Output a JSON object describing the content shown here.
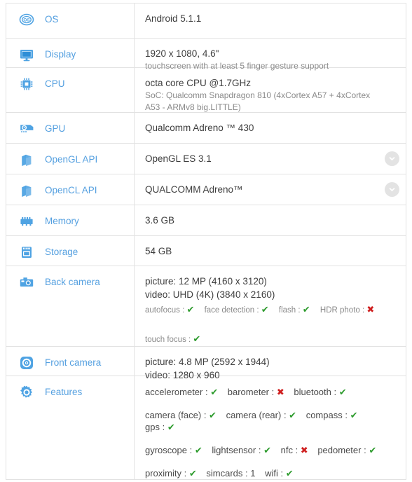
{
  "colors": {
    "label_blue": "#55a0e0",
    "icon_blue": "#4fa3e3",
    "value_dark": "#3d3d3d",
    "value_sub_gray": "#8a8a8a",
    "yes_green": "#2d9b2d",
    "no_red": "#cf1f1f",
    "border_gray": "#e2e2e2",
    "chevron_bg": "#e3e3e3"
  },
  "glyphs": {
    "check": "✔",
    "cross": "✖"
  },
  "rows": [
    {
      "key": "os",
      "icon": "os-icon",
      "label": "OS",
      "value_main": "Android 5.1.1",
      "expandable": false
    },
    {
      "key": "display",
      "icon": "display-monitor-icon",
      "label": "Display",
      "value_main": "1920 x 1080, 4.6\"",
      "value_sub": "touchscreen with at least 5 finger gesture support",
      "expandable": false
    },
    {
      "key": "cpu",
      "icon": "cpu-chip-icon",
      "label": "CPU",
      "value_main": "octa core CPU @1.7GHz",
      "value_sub": "SoC: Qualcomm Snapdragon 810 (4xCortex A57 + 4xCortex A53 - ARMv8 big.LITTLE)",
      "expandable": false
    },
    {
      "key": "gpu",
      "icon": "gpu-card-icon",
      "label": "GPU",
      "value_main": "Qualcomm Adreno ™ 430",
      "expandable": false
    },
    {
      "key": "opengl-api",
      "icon": "cube-3d-icon",
      "label": "OpenGL API",
      "value_main": "OpenGL ES 3.1",
      "expandable": true
    },
    {
      "key": "opencl-api",
      "icon": "cube-3d-icon",
      "label": "OpenCL API",
      "value_main": "QUALCOMM Adreno™",
      "expandable": true
    },
    {
      "key": "memory",
      "icon": "memory-ram-icon",
      "label": "Memory",
      "value_main": "3.6 GB",
      "expandable": false
    },
    {
      "key": "storage",
      "icon": "storage-card-icon",
      "label": "Storage",
      "value_main": "54 GB",
      "expandable": false
    },
    {
      "key": "back-camera",
      "icon": "camera-back-icon",
      "label": "Back camera",
      "value_main": "picture: 12 MP (4160 x 3120)",
      "value_main2": "video: UHD (4K) (3840 x 2160)",
      "expandable": false,
      "feature_lines": [
        [
          {
            "name": "autofocus",
            "state": "yes"
          },
          {
            "name": "face detection",
            "state": "yes"
          },
          {
            "name": "flash",
            "state": "yes"
          },
          {
            "name": "HDR photo",
            "state": "no"
          }
        ],
        [],
        [
          {
            "name": "touch focus",
            "state": "yes"
          }
        ]
      ]
    },
    {
      "key": "front-camera",
      "icon": "camera-front-icon",
      "label": "Front camera",
      "value_main": "picture: 4.8 MP (2592 x 1944)",
      "value_main2": "video: 1280 x 960",
      "expandable": false
    },
    {
      "key": "features",
      "icon": "gear-icon",
      "label": "Features",
      "expandable": false,
      "feature_lines_big": [
        [
          {
            "name": "accelerometer",
            "state": "yes"
          },
          {
            "name": "barometer",
            "state": "no"
          },
          {
            "name": "bluetooth",
            "state": "yes"
          }
        ],
        [
          {
            "name": "camera (face)",
            "state": "yes"
          },
          {
            "name": "camera (rear)",
            "state": "yes"
          },
          {
            "name": "compass",
            "state": "yes"
          },
          {
            "name": "gps",
            "state": "yes"
          }
        ],
        [
          {
            "name": "gyroscope",
            "state": "yes"
          },
          {
            "name": "lightsensor",
            "state": "yes"
          },
          {
            "name": "nfc",
            "state": "no"
          },
          {
            "name": "pedometer",
            "state": "yes"
          }
        ],
        [
          {
            "name": "proximity",
            "state": "yes"
          },
          {
            "name": "simcards",
            "state": "value",
            "value": "1"
          },
          {
            "name": "wifi",
            "state": "yes"
          }
        ]
      ]
    }
  ]
}
